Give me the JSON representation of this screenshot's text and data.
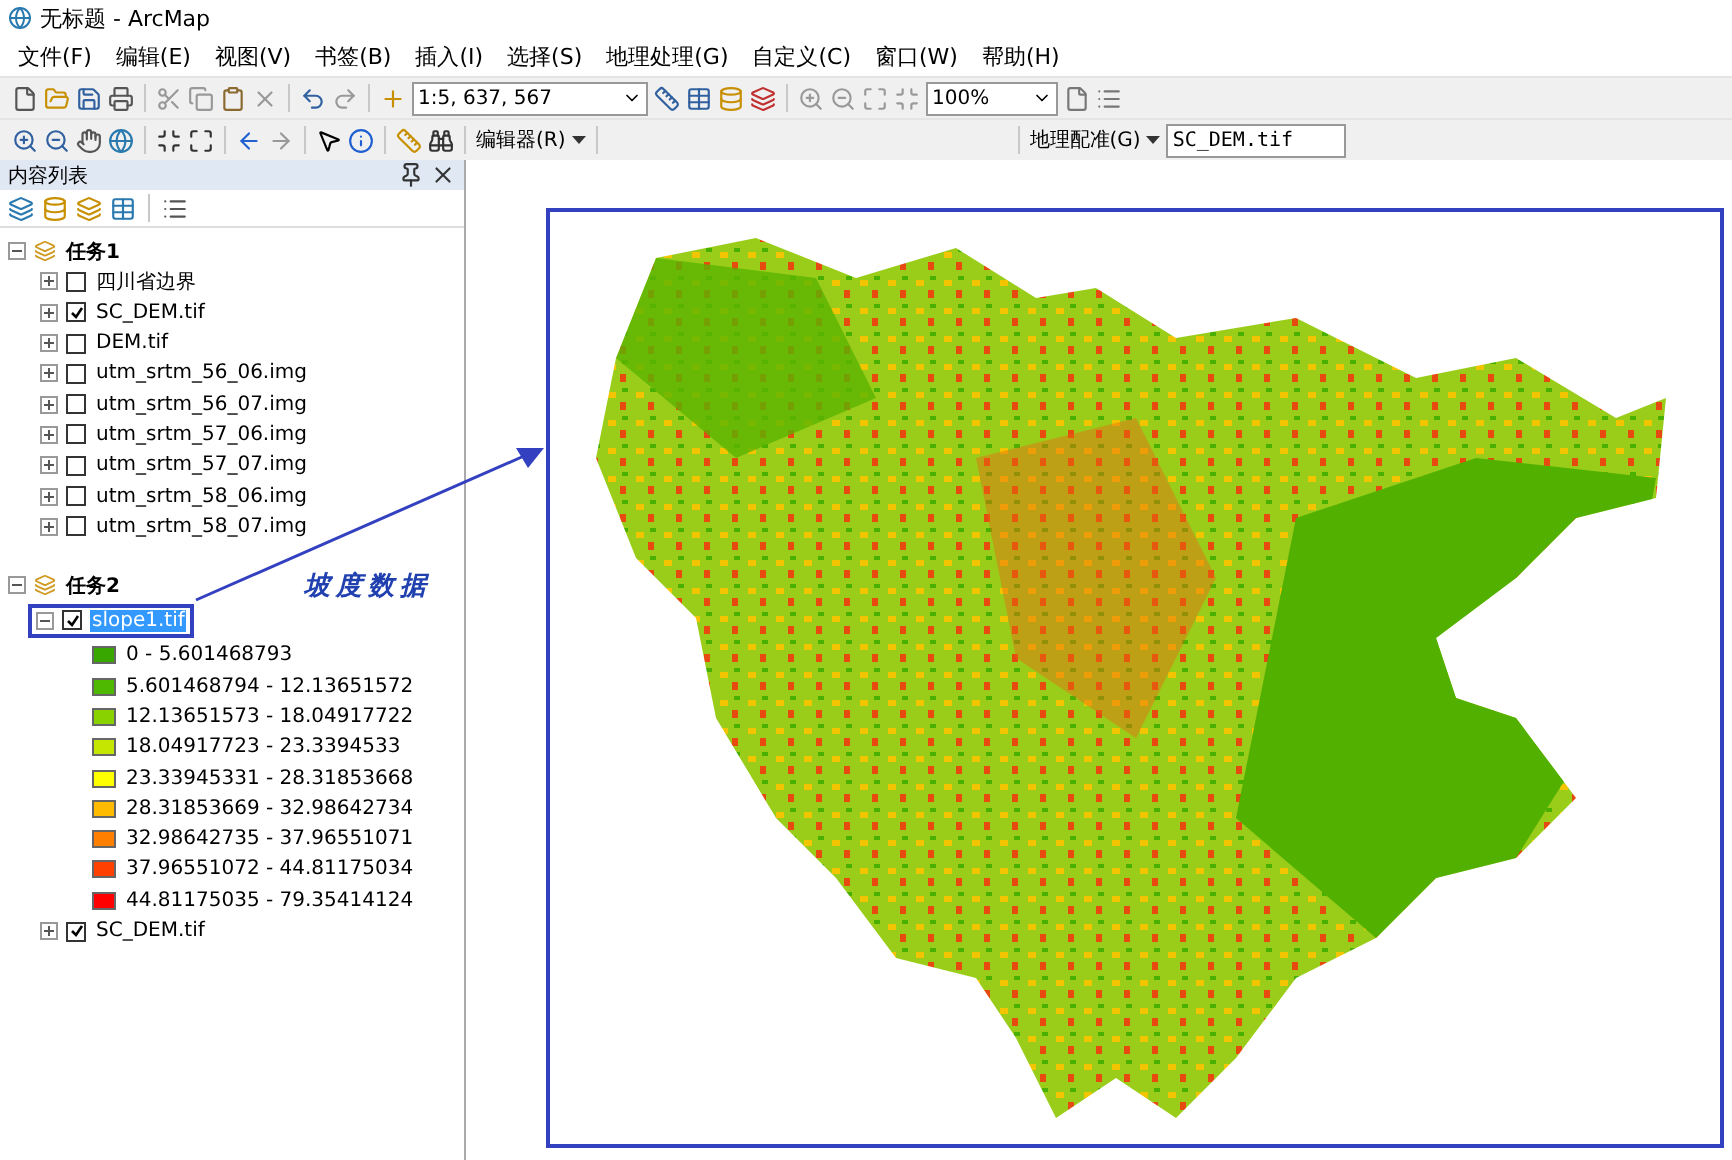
{
  "window": {
    "title": "无标题 - ArcMap"
  },
  "menu": [
    "文件(F)",
    "编辑(E)",
    "视图(V)",
    "书签(B)",
    "插入(I)",
    "选择(S)",
    "地理处理(G)",
    "自定义(C)",
    "窗口(W)",
    "帮助(H)"
  ],
  "toolbar": {
    "scale": "1:5, 637, 567",
    "zoom": "100%",
    "editor": "编辑器(R)",
    "georef": "地理配准(G)",
    "layer": "SC_DEM.tif"
  },
  "toc": {
    "title": "内容列表",
    "groups": [
      {
        "label": "任务1",
        "expanded": true,
        "children": [
          {
            "label": "四川省边界",
            "checked": false,
            "expanded": false,
            "selected": false
          },
          {
            "label": "SC_DEM.tif",
            "checked": true,
            "expanded": false,
            "selected": false
          },
          {
            "label": "DEM.tif",
            "checked": false,
            "expanded": false,
            "selected": false
          },
          {
            "label": "utm_srtm_56_06.img",
            "checked": false,
            "expanded": false,
            "selected": false
          },
          {
            "label": "utm_srtm_56_07.img",
            "checked": false,
            "expanded": false,
            "selected": false
          },
          {
            "label": "utm_srtm_57_06.img",
            "checked": false,
            "expanded": false,
            "selected": false
          },
          {
            "label": "utm_srtm_57_07.img",
            "checked": false,
            "expanded": false,
            "selected": false
          },
          {
            "label": "utm_srtm_58_06.img",
            "checked": false,
            "expanded": false,
            "selected": false
          },
          {
            "label": "utm_srtm_58_07.img",
            "checked": false,
            "expanded": false,
            "selected": false
          }
        ]
      },
      {
        "label": "任务2",
        "expanded": true,
        "children": [
          {
            "label": "slope1.tif",
            "checked": true,
            "expanded": true,
            "selected": true,
            "legend": [
              {
                "label": "0 - 5.601468793",
                "color": "#38a800"
              },
              {
                "label": "5.601468794 - 12.13651572",
                "color": "#4fb800"
              },
              {
                "label": "12.13651573 - 18.04917722",
                "color": "#8ad100"
              },
              {
                "label": "18.04917723 - 23.3394533",
                "color": "#c4e600"
              },
              {
                "label": "23.33945331 - 28.31853668",
                "color": "#ffff00"
              },
              {
                "label": "28.31853669 - 32.98642734",
                "color": "#ffbb00"
              },
              {
                "label": "32.98642735 - 37.96551071",
                "color": "#ff8000"
              },
              {
                "label": "37.96551072 - 44.81175034",
                "color": "#ff4000"
              },
              {
                "label": "44.81175035 - 79.35414124",
                "color": "#ff0000"
              }
            ]
          },
          {
            "label": "SC_DEM.tif",
            "checked": true,
            "expanded": false,
            "selected": false
          }
        ]
      }
    ]
  },
  "annotation": {
    "label": "坡度数据"
  }
}
